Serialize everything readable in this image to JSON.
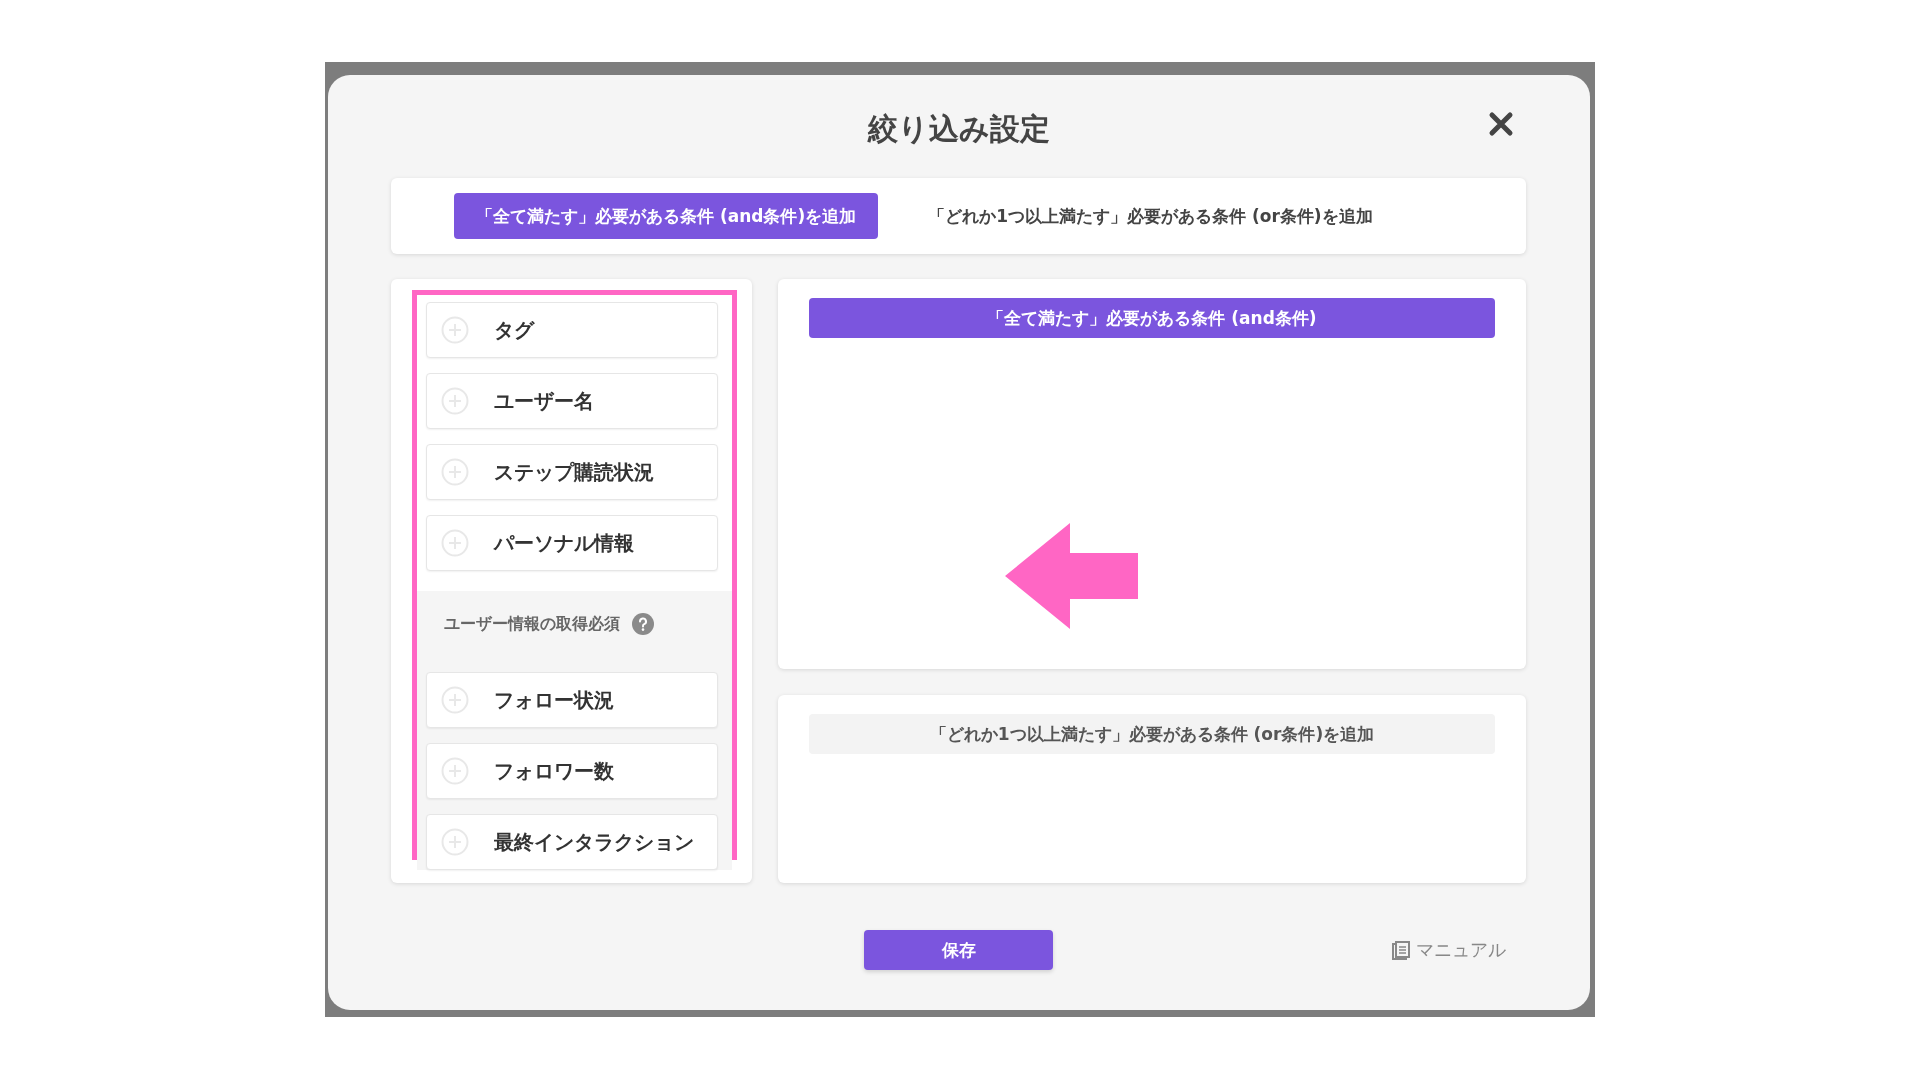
{
  "dialog": {
    "title": "絞り込み設定"
  },
  "tabs": [
    {
      "label": "「全て満たす」必要がある条件 (and条件)を追加",
      "selected": true
    },
    {
      "label": "「どれか1つ以上満たす」必要がある条件 (or条件)を追加",
      "selected": false
    }
  ],
  "condition_items": [
    {
      "kind": "item",
      "label": "タグ"
    },
    {
      "kind": "item",
      "label": "ユーザー名"
    },
    {
      "kind": "item",
      "label": "ステップ購読状況"
    },
    {
      "kind": "item",
      "label": "パーソナル情報"
    },
    {
      "kind": "section",
      "label": "ユーザー情報の取得必須"
    },
    {
      "kind": "item",
      "label": "フォロー状況"
    },
    {
      "kind": "item",
      "label": "フォロワー数"
    },
    {
      "kind": "item",
      "label": "最終インタラクション"
    }
  ],
  "condition_groups": [
    {
      "header": "「全て満たす」必要がある条件 (and条件)",
      "selected": true
    },
    {
      "header": "「どれか1つ以上満たす」必要がある条件 (or条件)を追加",
      "selected": false
    }
  ],
  "save_button": "保存",
  "manual_link": "マニュアル"
}
